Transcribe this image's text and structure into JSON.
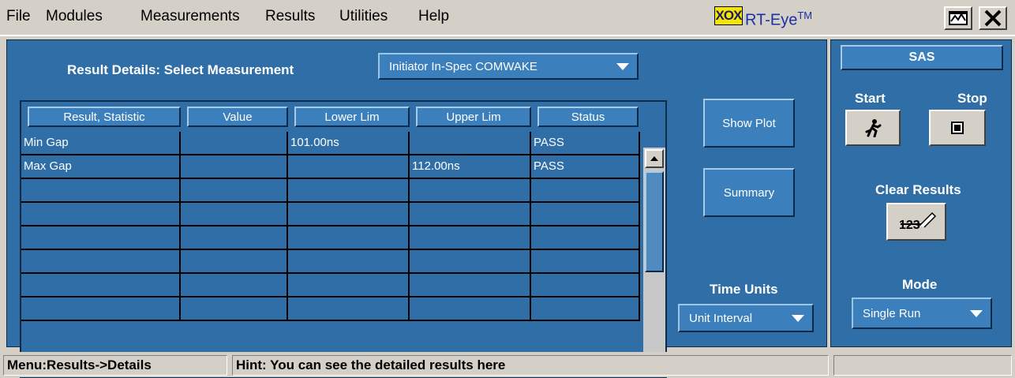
{
  "menu": {
    "items": [
      "File",
      "Modules",
      "Measurements",
      "Results",
      "Utilities",
      "Help"
    ]
  },
  "app": {
    "logo_text": "XOX",
    "title": "RT-Eye",
    "title_sup": "TM"
  },
  "details": {
    "select_label": "Result Details: Select Measurement",
    "selected_measurement": "Initiator In-Spec COMWAKE"
  },
  "table": {
    "columns": [
      "Result, Statistic",
      "Value",
      "Lower Lim",
      "Upper Lim",
      "Status"
    ],
    "rows": [
      [
        "Min Gap",
        "",
        "101.00ns",
        "",
        "PASS"
      ],
      [
        "Max Gap",
        "",
        "",
        "112.00ns",
        "PASS"
      ],
      [
        "",
        "",
        "",
        "",
        ""
      ],
      [
        "",
        "",
        "",
        "",
        ""
      ],
      [
        "",
        "",
        "",
        "",
        ""
      ],
      [
        "",
        "",
        "",
        "",
        ""
      ],
      [
        "",
        "",
        "",
        "",
        ""
      ],
      [
        "",
        "",
        "",
        "",
        ""
      ]
    ]
  },
  "actions": {
    "show_plot": "Show Plot",
    "summary": "Summary",
    "time_units_label": "Time Units",
    "time_units_value": "Unit Interval"
  },
  "right_panel": {
    "protocol": "SAS",
    "start_label": "Start",
    "stop_label": "Stop",
    "clear_results_label": "Clear Results",
    "clear_icon_text": "123",
    "mode_label": "Mode",
    "mode_value": "Single Run"
  },
  "status": {
    "menu_path": "Menu:Results->Details",
    "hint": "Hint: You can see the detailed results here"
  },
  "colors": {
    "panel_blue": "#2f6ea6",
    "button_blue": "#3c7fbd",
    "chrome_gray": "#d4d0c8"
  }
}
